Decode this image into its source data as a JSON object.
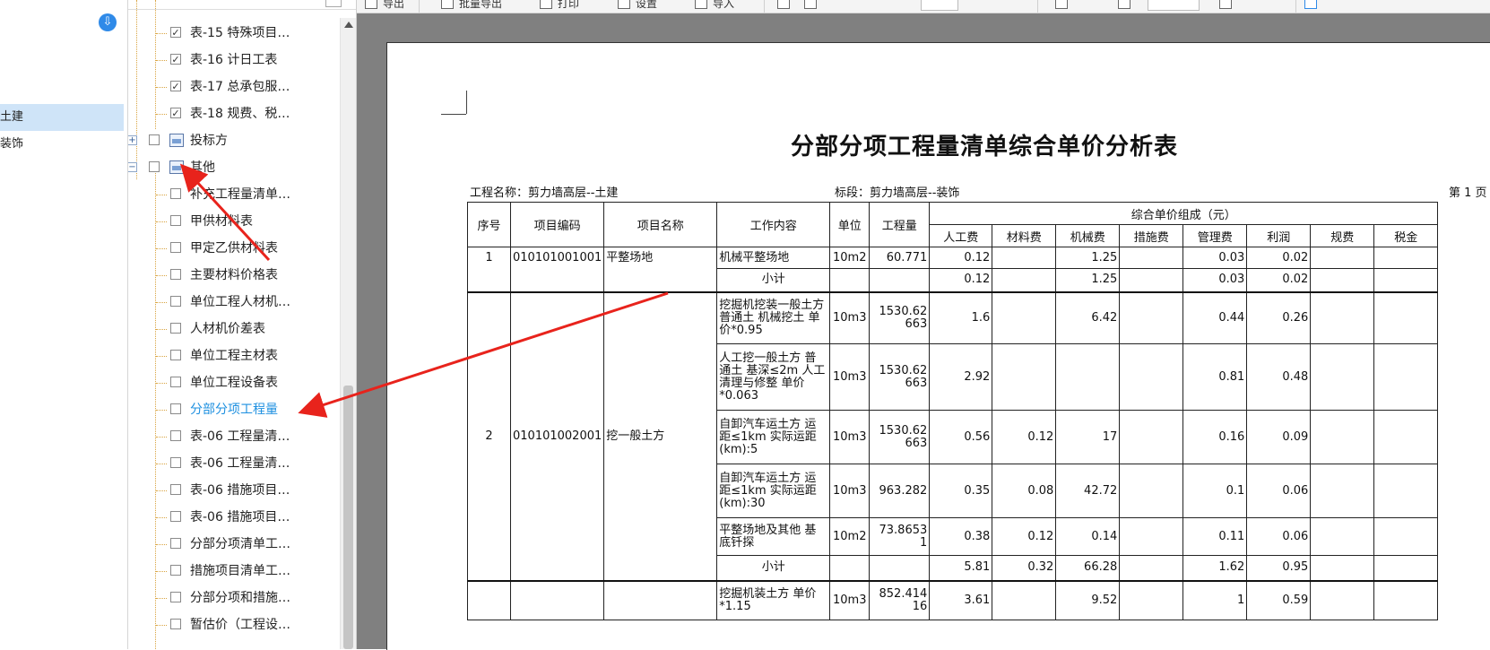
{
  "toolbar": {
    "buttons": [
      {
        "name": "toolbar-btn-1",
        "label": "导出"
      },
      {
        "name": "toolbar-btn-2",
        "label": "批量导出"
      },
      {
        "name": "toolbar-btn-3",
        "label": "打印"
      },
      {
        "name": "toolbar-btn-4",
        "label": "设置"
      },
      {
        "name": "toolbar-btn-5",
        "label": "导入"
      }
    ]
  },
  "project": {
    "items": [
      "土建",
      "装饰"
    ],
    "selected_index": 0
  },
  "tree": {
    "items": [
      {
        "label": "表-15 特殊项目…",
        "checked": true,
        "level": 2
      },
      {
        "label": "表-16 计日工表",
        "checked": true,
        "level": 2
      },
      {
        "label": "表-17 总承包服…",
        "checked": true,
        "level": 2
      },
      {
        "label": "表-18 规费、税…",
        "checked": true,
        "level": 2
      },
      {
        "label": "投标方",
        "checked": false,
        "level": 1,
        "expander": "+"
      },
      {
        "label": "其他",
        "checked": false,
        "level": 1,
        "expander": "−"
      },
      {
        "label": "补充工程量清单…",
        "checked": false,
        "level": 2
      },
      {
        "label": "甲供材料表",
        "checked": false,
        "level": 2
      },
      {
        "label": "甲定乙供材料表",
        "checked": false,
        "level": 2
      },
      {
        "label": "主要材料价格表",
        "checked": false,
        "level": 2
      },
      {
        "label": "单位工程人材机…",
        "checked": false,
        "level": 2
      },
      {
        "label": "人材机价差表",
        "checked": false,
        "level": 2
      },
      {
        "label": "单位工程主材表",
        "checked": false,
        "level": 2
      },
      {
        "label": "单位工程设备表",
        "checked": false,
        "level": 2
      },
      {
        "label": "分部分项工程量",
        "checked": false,
        "level": 2,
        "active": true
      },
      {
        "label": "表-06 工程量清…",
        "checked": false,
        "level": 2
      },
      {
        "label": "表-06 工程量清…",
        "checked": false,
        "level": 2
      },
      {
        "label": "表-06 措施项目…",
        "checked": false,
        "level": 2
      },
      {
        "label": "表-06 措施项目…",
        "checked": false,
        "level": 2
      },
      {
        "label": "分部分项清单工…",
        "checked": false,
        "level": 2
      },
      {
        "label": "措施项目清单工…",
        "checked": false,
        "level": 2
      },
      {
        "label": "分部分项和措施…",
        "checked": false,
        "level": 2
      },
      {
        "label": "暂估价（工程设…",
        "checked": false,
        "level": 2
      }
    ]
  },
  "report": {
    "title": "分部分项工程量清单综合单价分析表",
    "project_name": "工程名称：剪力墙高层--土建",
    "section": "标段：剪力墙高层--装饰",
    "page": "第 1 页",
    "headers": {
      "seq": "序号",
      "code": "项目编码",
      "name": "项目名称",
      "work": "工作内容",
      "unit": "单位",
      "qty": "工程量",
      "group": "综合单价组成（元）",
      "labor": "人工费",
      "material": "材料费",
      "machine": "机械费",
      "measure": "措施费",
      "mgmt": "管理费",
      "profit": "利润",
      "fee": "规费",
      "tax": "税金"
    },
    "items": [
      {
        "seq": "1",
        "code": "010101001001",
        "name": "平整场地",
        "rows": [
          {
            "work": "机械平整场地",
            "unit": "10m2",
            "qty": "60.771",
            "labor": "0.12",
            "material": "",
            "machine": "1.25",
            "measure": "",
            "mgmt": "0.03",
            "profit": "0.02"
          },
          {
            "work": "小计",
            "unit": "",
            "qty": "",
            "labor": "0.12",
            "material": "",
            "machine": "1.25",
            "measure": "",
            "mgmt": "0.03",
            "profit": "0.02",
            "subtotal": true
          }
        ]
      },
      {
        "seq": "2",
        "code": "010101002001",
        "name": "挖一般土方",
        "rows": [
          {
            "work": "挖掘机挖装一般土方 普通土 机械挖土 单价*0.95",
            "unit": "10m3",
            "qty": "1530.62663",
            "labor": "1.6",
            "material": "",
            "machine": "6.42",
            "measure": "",
            "mgmt": "0.44",
            "profit": "0.26"
          },
          {
            "work": "人工挖一般土方 普通土 基深≤2m 人工清理与修整 单价*0.063",
            "unit": "10m3",
            "qty": "1530.62663",
            "labor": "2.92",
            "material": "",
            "machine": "",
            "measure": "",
            "mgmt": "0.81",
            "profit": "0.48"
          },
          {
            "work": "自卸汽车运土方 运距≤1km 实际运距(km):5",
            "unit": "10m3",
            "qty": "1530.62663",
            "labor": "0.56",
            "material": "0.12",
            "machine": "17",
            "measure": "",
            "mgmt": "0.16",
            "profit": "0.09"
          },
          {
            "work": "自卸汽车运土方 运距≤1km 实际运距(km):30",
            "unit": "10m3",
            "qty": "963.282",
            "labor": "0.35",
            "material": "0.08",
            "machine": "42.72",
            "measure": "",
            "mgmt": "0.1",
            "profit": "0.06"
          },
          {
            "work": "平整场地及其他 基底钎探",
            "unit": "10m2",
            "qty": "73.86531",
            "labor": "0.38",
            "material": "0.12",
            "machine": "0.14",
            "measure": "",
            "mgmt": "0.11",
            "profit": "0.06"
          },
          {
            "work": "小计",
            "unit": "",
            "qty": "",
            "labor": "5.81",
            "material": "0.32",
            "machine": "66.28",
            "measure": "",
            "mgmt": "1.62",
            "profit": "0.95",
            "subtotal": true
          }
        ]
      },
      {
        "seq": "",
        "code": "",
        "name": "",
        "rows": [
          {
            "work": "挖掘机装土方 单价*1.15",
            "unit": "10m3",
            "qty": "852.41416",
            "labor": "3.61",
            "material": "",
            "machine": "9.52",
            "measure": "",
            "mgmt": "1",
            "profit": "0.59"
          }
        ]
      }
    ]
  },
  "colors": {
    "accent": "#1e90e0",
    "arrow": "#e8231c",
    "selection": "#cfe4f8",
    "preview_bg": "#808080"
  }
}
